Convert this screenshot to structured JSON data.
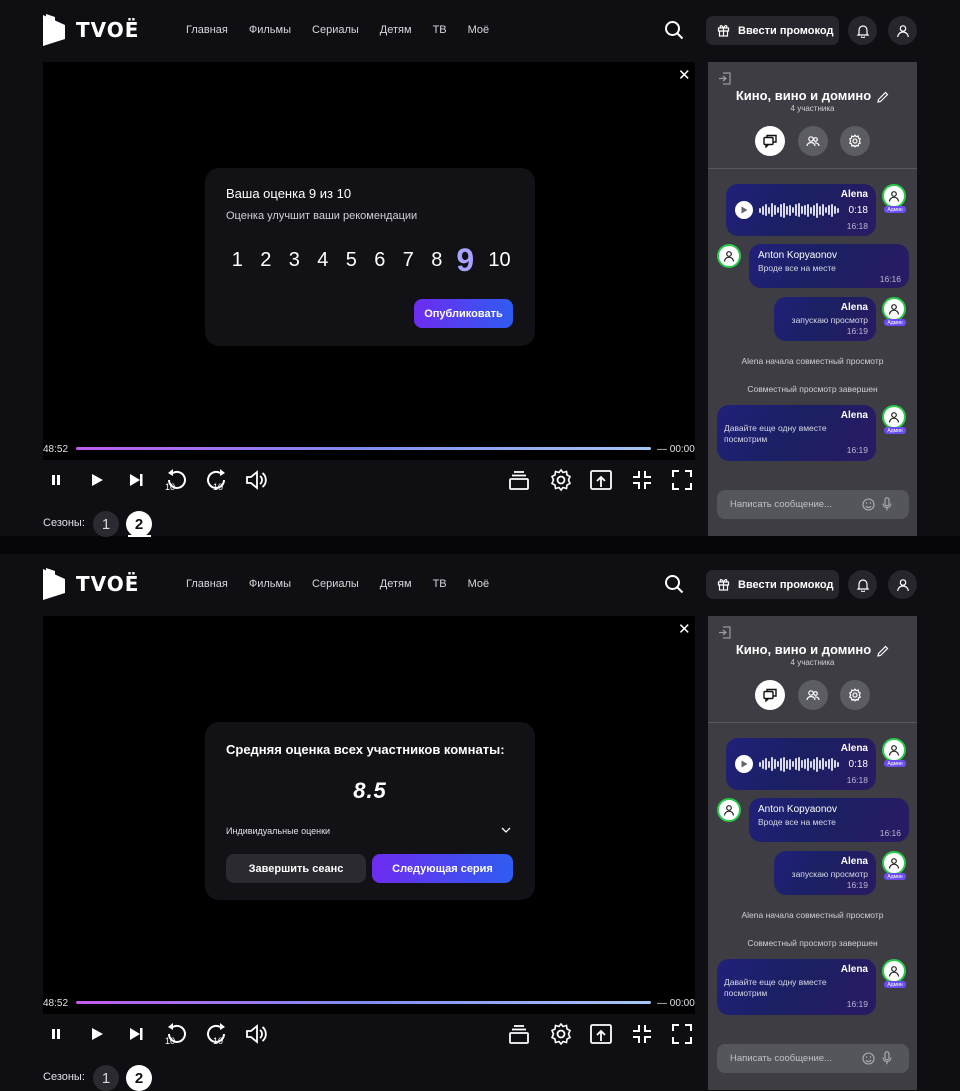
{
  "brand": {
    "name": "TVOЁ"
  },
  "nav": [
    "Главная",
    "Фильмы",
    "Сериалы",
    "Детям",
    "ТВ",
    "Моё"
  ],
  "header": {
    "promo_label": "Ввести промокод"
  },
  "rating_dialog": {
    "title": "Ваша оценка 9 из 10",
    "subtitle": "Оценка улучшит ваши рекомендации",
    "numbers": [
      "1",
      "2",
      "3",
      "4",
      "5",
      "6",
      "7",
      "8",
      "9",
      "10"
    ],
    "selected": "9",
    "publish_label": "Опубликовать"
  },
  "average_dialog": {
    "title": "Средняя оценка всех участников комнаты:",
    "value": "8.5",
    "individual_label": "Индивидуальные оценки",
    "end_label": "Завершить сеанс",
    "next_label": "Следующая серия"
  },
  "player": {
    "time_elapsed": "48:52",
    "time_remaining": "— 00:00",
    "progress": 1.0
  },
  "seasons": {
    "label": "Сезоны:",
    "items": [
      "1",
      "2"
    ],
    "selected": "2"
  },
  "chat": {
    "room_name": "Кино, вино и домино",
    "members": "4 участника",
    "messages": [
      {
        "author": "Alena",
        "duration": "0:18",
        "time": "16:18",
        "badge": "Админ"
      },
      {
        "author": "Anton Kopyaonov",
        "text": "Вроде все на месте",
        "time": "16:16"
      },
      {
        "author": "Alena",
        "text": "запускаю просмотр",
        "time": "16:19",
        "badge": "Админ"
      },
      {
        "author": "Alena",
        "text": "Давайте еще одну вместе посмотрим",
        "time": "16:19",
        "badge": "Админ"
      }
    ],
    "system_messages": [
      "Alena начала совместный просмотр",
      "Совместный просмотр завершен"
    ],
    "input_placeholder": "Написать сообщение..."
  },
  "colors": {
    "accent": "#6d2cf0",
    "accent2": "#2f5cf0",
    "online": "#2ac94c",
    "selected_rating": "#a9a3ff"
  }
}
